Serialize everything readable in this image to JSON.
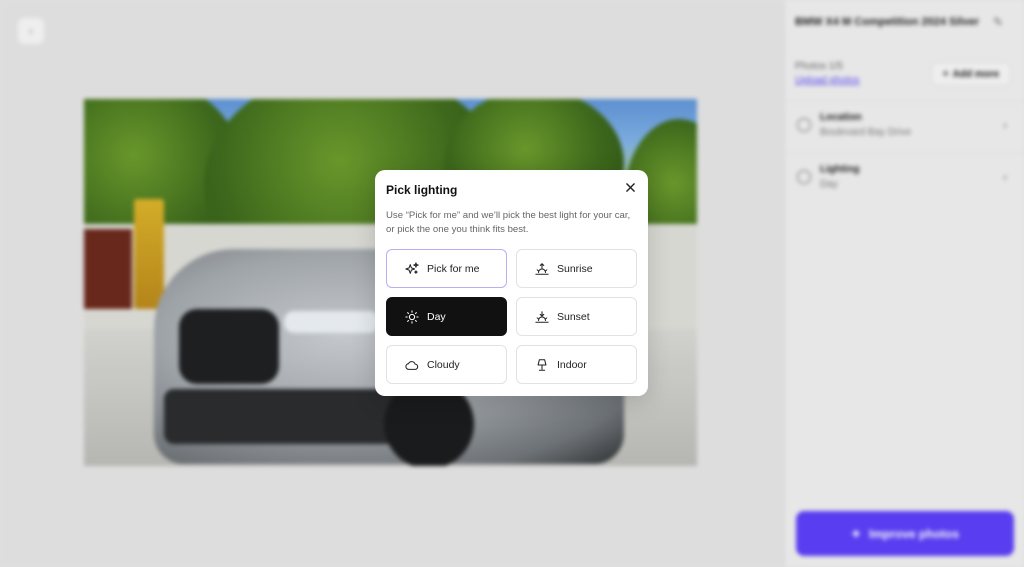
{
  "sidebar": {
    "title": "BMW X4 M Competition 2024 Silver",
    "photos_label": "Photos 1/5",
    "link_text": "Upload photos",
    "add_label": "Add more",
    "rows": [
      {
        "label": "Location",
        "value": "Boulevard Bay Drive"
      },
      {
        "label": "Lighting",
        "value": "Day"
      }
    ],
    "improve_label": "Improve photos"
  },
  "modal": {
    "title": "Pick lighting",
    "description": "Use “Pick for me” and we’ll pick the best light for your car, or pick the one you think fits best.",
    "options": [
      {
        "label": "Pick for me",
        "icon": "sparkles-icon",
        "state": "suggested"
      },
      {
        "label": "Sunrise",
        "icon": "sunrise-icon",
        "state": "default"
      },
      {
        "label": "Day",
        "icon": "sun-icon",
        "state": "selected"
      },
      {
        "label": "Sunset",
        "icon": "sunset-icon",
        "state": "default"
      },
      {
        "label": "Cloudy",
        "icon": "cloud-icon",
        "state": "default"
      },
      {
        "label": "Indoor",
        "icon": "lamp-icon",
        "state": "default"
      }
    ]
  },
  "colors": {
    "accent": "#5b3ff5",
    "selected_bg": "#111111",
    "suggested_border": "#b7b0f3"
  }
}
